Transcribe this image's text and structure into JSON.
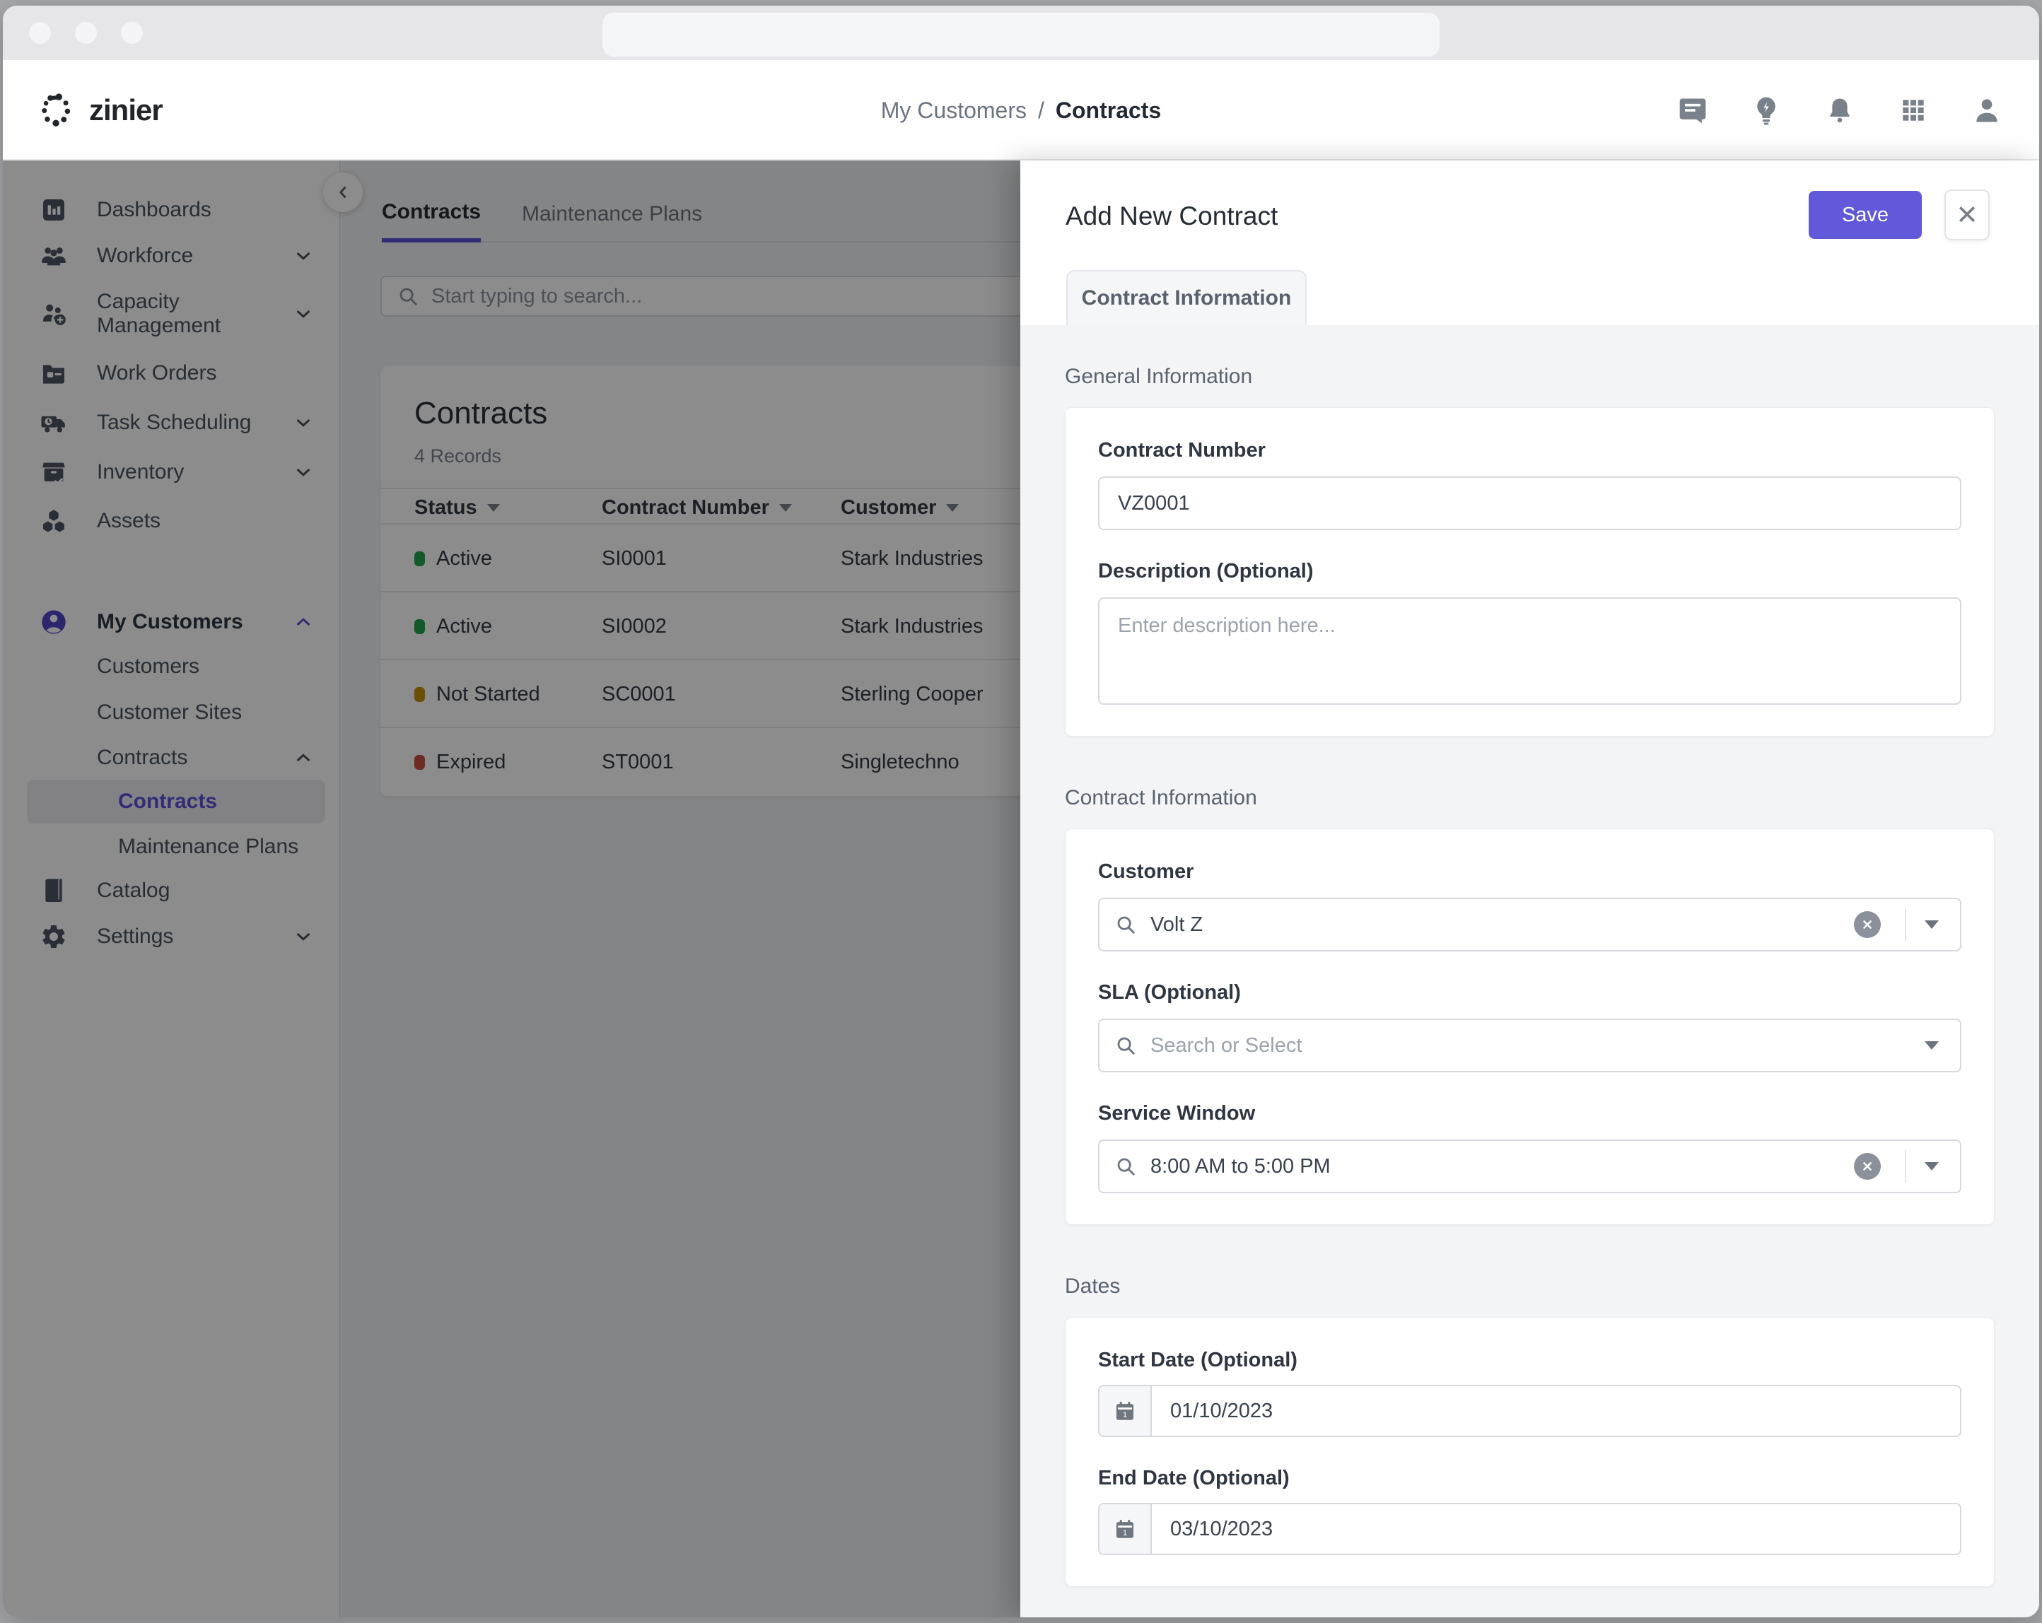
{
  "colors": {
    "accent": "#5b50d8",
    "save_button": "#6159d9",
    "status_active": "#1fa34c",
    "status_not_started": "#c29200",
    "status_expired": "#c94f43",
    "overlay": "rgba(0,0,0,0.45)"
  },
  "header": {
    "logo_text": "zinier",
    "breadcrumb": {
      "parent": "My Customers",
      "separator": "/",
      "current": "Contracts"
    },
    "icons": [
      "comment-icon",
      "lightbulb-icon",
      "bell-icon",
      "grid-icon",
      "person-icon"
    ]
  },
  "sidebar": {
    "items": [
      {
        "label": "Dashboards",
        "icon": "dashboard-icon"
      },
      {
        "label": "Workforce",
        "icon": "workforce-icon",
        "chevron": "down"
      },
      {
        "label": "Capacity Management",
        "icon": "capacity-icon",
        "chevron": "down"
      },
      {
        "label": "Work Orders",
        "icon": "work-orders-icon"
      },
      {
        "label": "Task Scheduling",
        "icon": "task-scheduling-icon",
        "chevron": "down"
      },
      {
        "label": "Inventory",
        "icon": "inventory-icon",
        "chevron": "down"
      },
      {
        "label": "Assets",
        "icon": "assets-icon"
      },
      {
        "label": "My Customers",
        "icon": "my-customers-icon",
        "chevron": "up"
      },
      {
        "label": "Customers"
      },
      {
        "label": "Customer Sites"
      },
      {
        "label": "Contracts",
        "chevron": "up"
      },
      {
        "label": "Contracts",
        "active": true
      },
      {
        "label": "Maintenance Plans"
      },
      {
        "label": "Catalog",
        "icon": "catalog-icon"
      },
      {
        "label": "Settings",
        "icon": "settings-icon",
        "chevron": "down"
      }
    ]
  },
  "main": {
    "tabs": [
      {
        "label": "Contracts",
        "active": true
      },
      {
        "label": "Maintenance Plans",
        "active": false
      }
    ],
    "search_placeholder": "Start typing to search...",
    "card": {
      "title": "Contracts",
      "records": "4 Records"
    },
    "table": {
      "headers": [
        "Status",
        "Contract Number",
        "Customer"
      ],
      "rows": [
        {
          "status": "Active",
          "status_color": "#1fa34c",
          "contract_number": "SI0001",
          "customer": "Stark Industries"
        },
        {
          "status": "Active",
          "status_color": "#1fa34c",
          "contract_number": "SI0002",
          "customer": "Stark Industries"
        },
        {
          "status": "Not Started",
          "status_color": "#c29200",
          "contract_number": "SC0001",
          "customer": "Sterling Cooper"
        },
        {
          "status": "Expired",
          "status_color": "#c94f43",
          "contract_number": "ST0001",
          "customer": "Singletechno"
        }
      ]
    }
  },
  "drawer": {
    "title": "Add New Contract",
    "save_label": "Save",
    "close_label": "✕",
    "tab": "Contract Information",
    "general": {
      "title": "General Information",
      "contract_number": {
        "label": "Contract Number",
        "value": "VZ0001"
      },
      "description": {
        "label": "Description (Optional)",
        "placeholder": "Enter description here..."
      }
    },
    "contract_info": {
      "title": "Contract Information",
      "customer": {
        "label": "Customer",
        "value": "Volt Z"
      },
      "sla": {
        "label": "SLA (Optional)",
        "placeholder": "Search or Select"
      },
      "service_window": {
        "label": "Service Window",
        "value": "8:00 AM to 5:00 PM"
      }
    },
    "dates": {
      "title": "Dates",
      "start": {
        "label": "Start Date (Optional)",
        "value": "01/10/2023"
      },
      "end": {
        "label": "End Date (Optional)",
        "value": "03/10/2023"
      }
    }
  }
}
